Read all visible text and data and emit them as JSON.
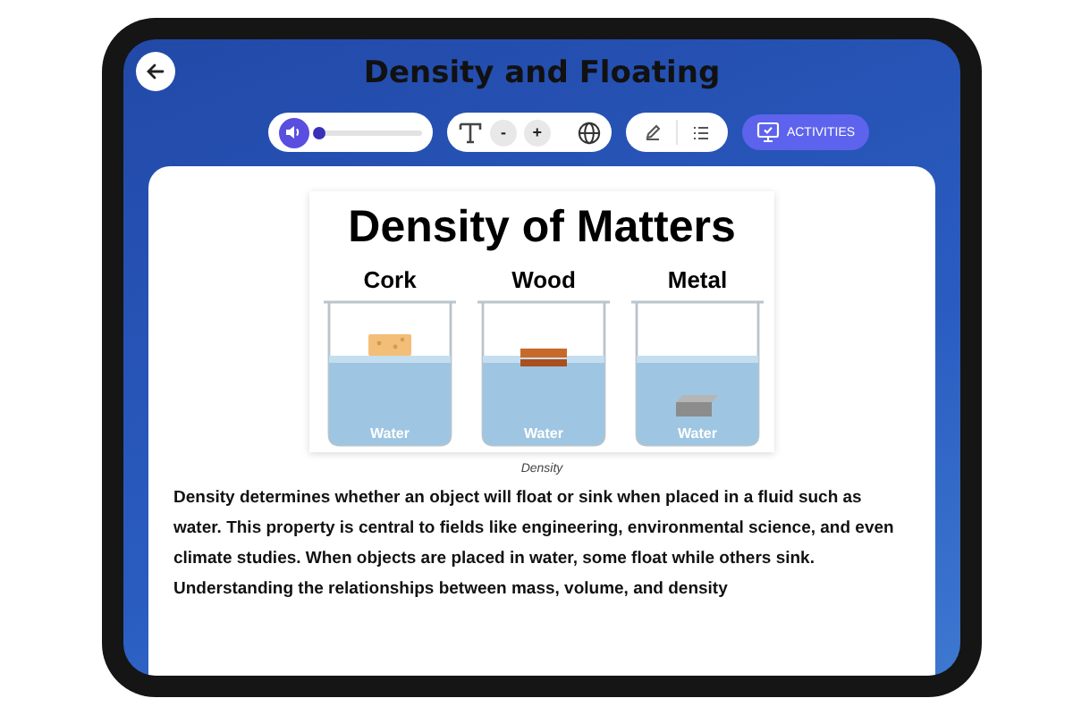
{
  "header": {
    "title": "Density and Floating"
  },
  "toolbar": {
    "volume": {
      "level": 0.03
    },
    "font_size": {
      "decrease": "-",
      "increase": "+"
    },
    "activities": {
      "label": "ACTIVITIES"
    }
  },
  "figure": {
    "title": "Density of Matters",
    "beakers": [
      {
        "label": "Cork",
        "liquid": "Water",
        "kind": "cork"
      },
      {
        "label": "Wood",
        "liquid": "Water",
        "kind": "wood"
      },
      {
        "label": "Metal",
        "liquid": "Water",
        "kind": "metal"
      }
    ],
    "caption": "Density"
  },
  "paragraph": "Density determines whether an object will float or sink when placed in a fluid such as water. This property is central to fields like engineering, environmental science, and even climate studies. When objects are placed in water, some float while others sink. Understanding the relationships between mass, volume, and density"
}
